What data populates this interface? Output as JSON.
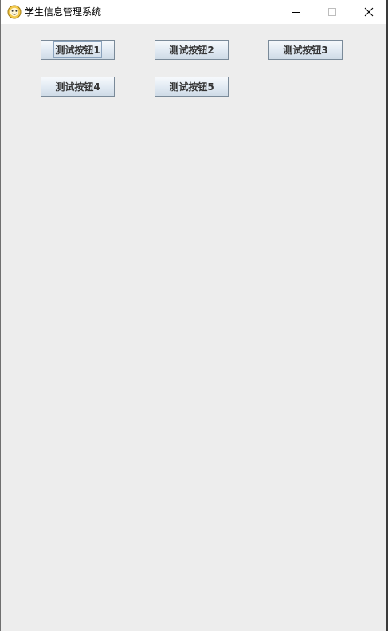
{
  "window": {
    "title": "学生信息管理系统",
    "app_icon": "ji-logo-icon",
    "controls": {
      "minimize": "minimize-icon",
      "maximize": "maximize-icon",
      "close": "close-icon"
    }
  },
  "buttons": [
    {
      "label": "测试按钮1",
      "focused": true
    },
    {
      "label": "测试按钮2",
      "focused": false
    },
    {
      "label": "测试按钮3",
      "focused": false
    },
    {
      "label": "测试按钮4",
      "focused": false
    },
    {
      "label": "测试按钮5",
      "focused": false
    }
  ],
  "colors": {
    "background": "#ededed",
    "titlebar": "#ffffff",
    "button_border": "#7a8a99",
    "button_text": "#333333"
  }
}
